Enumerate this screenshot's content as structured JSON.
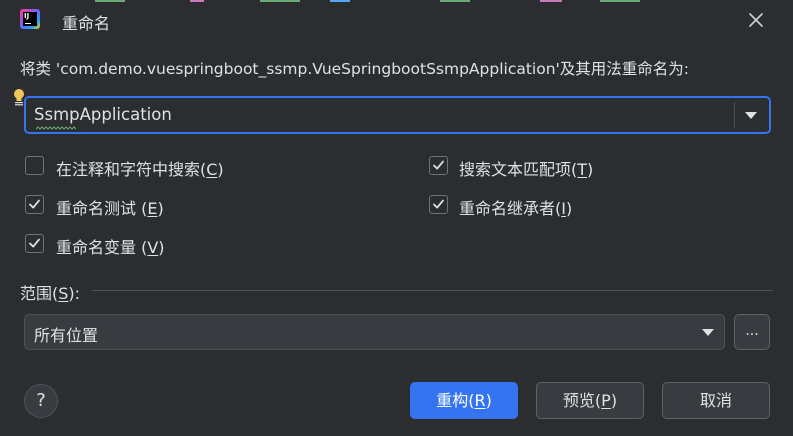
{
  "window": {
    "title": "重命名"
  },
  "prompt": "将类 'com.demo.vuespringboot_ssmp.VueSpringbootSsmpApplication'及其用法重命名为:",
  "name_field": {
    "value": "SsmpApplication"
  },
  "options": [
    {
      "label_before": "在注释和字符中搜索(",
      "mnemonic": "C",
      "label_after": ")",
      "checked": false
    },
    {
      "label_before": "搜索文本匹配项(",
      "mnemonic": "T",
      "label_after": ")",
      "checked": true
    },
    {
      "label_before": "重命名测试 (",
      "mnemonic": "E",
      "label_after": ")",
      "checked": true
    },
    {
      "label_before": "重命名继承者(",
      "mnemonic": "I",
      "label_after": ")",
      "checked": true
    },
    {
      "label_before": "重命名变量 (",
      "mnemonic": "V",
      "label_after": ")",
      "checked": true
    }
  ],
  "scope": {
    "label_before": "范围(",
    "mnemonic": "S",
    "label_after": "):",
    "selected": "所有位置",
    "more_label": "..."
  },
  "buttons": {
    "help": "?",
    "refactor": {
      "before": "重构(",
      "mnemonic": "R",
      "after": ")"
    },
    "preview": {
      "before": "预览(",
      "mnemonic": "P",
      "after": ")"
    },
    "cancel": "取消"
  },
  "colors": {
    "background": "#2b2d30",
    "accent": "#3574f0",
    "text": "#dfe1e5",
    "field": "#393b40"
  }
}
